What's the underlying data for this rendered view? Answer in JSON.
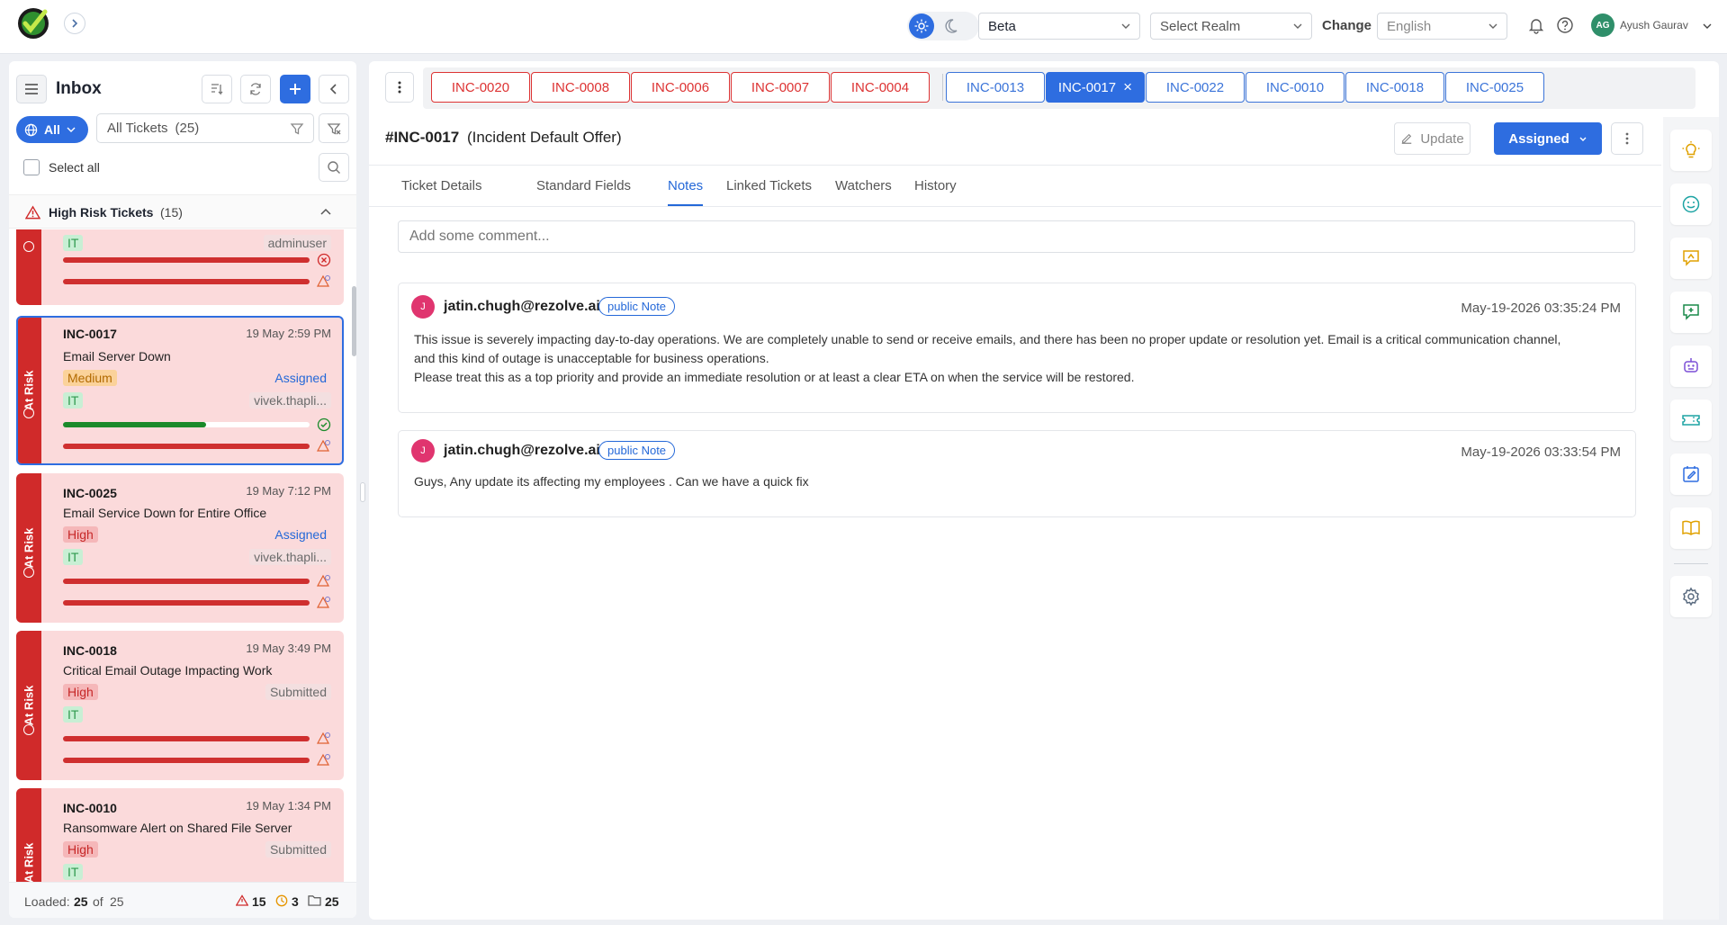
{
  "topbar": {
    "env_value": "Beta",
    "realm_placeholder": "Select Realm",
    "change_label": "Change",
    "language_value": "English",
    "user_initials": "AG",
    "user_name": "Ayush Gaurav"
  },
  "sidebar": {
    "title": "Inbox",
    "filter_scope": "All",
    "ticket_filter": "All Tickets",
    "ticket_count": "(25)",
    "select_all": "Select all",
    "group_title": "High Risk Tickets",
    "group_count": "(15)",
    "at_risk_label": "At Risk",
    "cards": [
      {
        "user": "adminuser",
        "category": "IT"
      },
      {
        "id": "INC-0017",
        "time": "19 May 2:59 PM",
        "title": "Email Server Down",
        "priority": "Medium",
        "status": "Assigned",
        "category": "IT",
        "user": "vivek.thapli...",
        "progress1": 0.58,
        "progress2": 1.0
      },
      {
        "id": "INC-0025",
        "time": "19 May 7:12 PM",
        "title": "Email Service Down for Entire Office",
        "priority": "High",
        "status": "Assigned",
        "category": "IT",
        "user": "vivek.thapli..."
      },
      {
        "id": "INC-0018",
        "time": "19 May 3:49 PM",
        "title": "Critical Email Outage Impacting Work",
        "priority": "High",
        "status": "Submitted",
        "category": "IT"
      },
      {
        "id": "INC-0010",
        "time": "19 May 1:34 PM",
        "title": "Ransomware Alert on Shared File Server",
        "priority": "High",
        "status": "Submitted",
        "category": "IT"
      }
    ],
    "footer": {
      "loaded_label": "Loaded:",
      "loaded": "25",
      "of_label": "of",
      "total": "25",
      "risk_count": "15",
      "warn_count": "3",
      "folder_count": "25"
    }
  },
  "tabs": {
    "red": [
      "INC-0020",
      "INC-0008",
      "INC-0006",
      "INC-0007",
      "INC-0004"
    ],
    "blue": [
      "INC-0013",
      "INC-0017",
      "INC-0022",
      "INC-0010",
      "INC-0018",
      "INC-0025"
    ],
    "active": "INC-0017"
  },
  "ticket": {
    "heading_id": "#INC-0017",
    "heading_name": "(Incident Default Offer)",
    "update_label": "Update",
    "status_label": "Assigned",
    "subtabs": [
      "Ticket Details",
      "Standard Fields",
      "Notes",
      "Linked Tickets",
      "Watchers",
      "History"
    ],
    "active_subtab": "Notes",
    "comment_placeholder": "Add some comment...",
    "notes": [
      {
        "initial": "J",
        "author": "jatin.chugh@rezolve.ai",
        "tag": "public Note",
        "time": "May-19-2026 03:35:24 PM",
        "line1": "This issue is severely impacting day-to-day operations. We are completely unable to send or receive emails, and there has been no proper update or resolution yet. Email is a critical communication channel,",
        "line2": "and this kind of outage is unacceptable for business operations.",
        "line3": "Please treat this as a top priority and provide an immediate resolution or at least a clear ETA on when the service will be restored."
      },
      {
        "initial": "J",
        "author": "jatin.chugh@rezolve.ai",
        "tag": "public Note",
        "time": "May-19-2026 03:33:54 PM",
        "line1": "Guys, Any update its affecting my employees . Can we have a quick fix"
      }
    ]
  },
  "colors": {
    "accent": "#2e6de0",
    "risk": "#d02a2a",
    "card": "#fbdadb"
  }
}
